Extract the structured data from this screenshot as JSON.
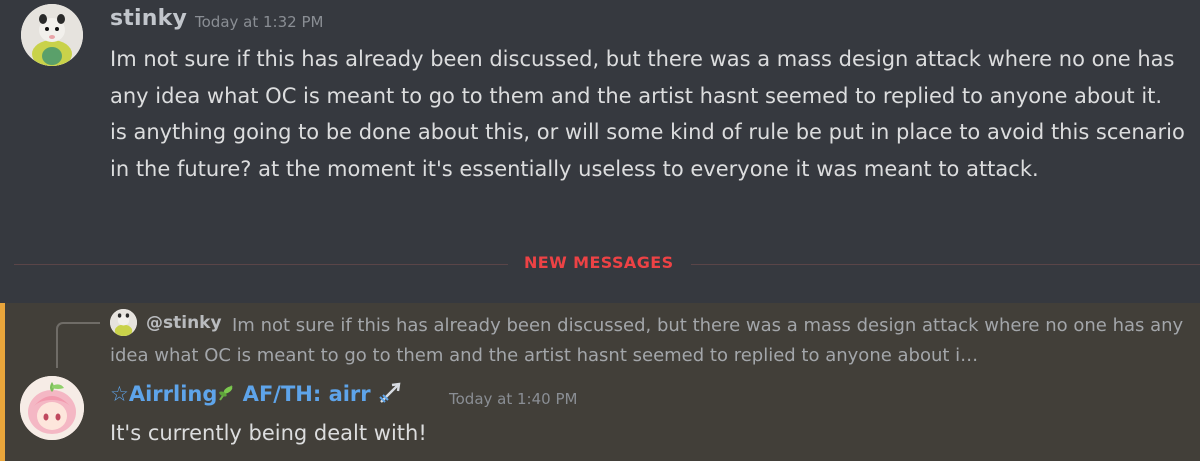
{
  "messages": {
    "first": {
      "author": "stinky",
      "timestamp": "Today at 1:32 PM",
      "text": "Im not sure if this has already been discussed, but there was a mass design attack where no one has any idea what OC is meant to go to them and the artist hasnt seemed to replied to anyone about it. is anything going to be done about this, or will some kind of rule be put in place to avoid this scenario in the future? at the moment it's essentially useless to everyone it was meant to attack."
    },
    "divider": {
      "label": "NEW MESSAGES",
      "color": "#ed4245"
    },
    "reply": {
      "quoted_author": "@stinky",
      "quoted_text": "Im not sure if this has already been discussed, but there was a mass design attack where no one has any idea what OC is meant to go to them and the artist hasnt seemed to replied to anyone about i…",
      "author_prefix": "☆Airrling",
      "author_suffix": " AF/TH: airr",
      "timestamp": "Today at 1:40 PM",
      "text": "It's currently being dealt with!",
      "author_color": "#5ea4ea",
      "highlight_color": "#e9a53b"
    }
  },
  "icons": {
    "first_avatar": "opossum-avatar-icon",
    "reply_avatar": "opossum-avatar-icon",
    "second_avatar": "anime-girl-avatar-icon",
    "sprout": "sprout-icon",
    "badge": "cupid-arrow-icon"
  }
}
